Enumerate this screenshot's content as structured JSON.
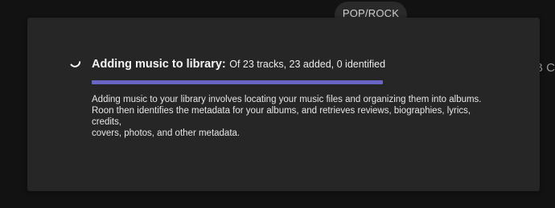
{
  "background": {
    "genre_pill": "POP/ROCK",
    "edge_text": "B C"
  },
  "dialog": {
    "spinner_icon": "loading-spinner-icon",
    "title": "Adding music to library:",
    "detail": "Of 23 tracks, 23 added, 0 identified",
    "progress_fraction": 1.0,
    "accent_color": "#6865c4",
    "description_line_1": "Adding music to your library involves locating your music files and organizing them into albums.",
    "description_line_2": "Roon then identifies the metadata for your albums, and retrieves reviews, biographies, lyrics, credits,",
    "description_line_3": "covers, photos, and other metadata."
  }
}
